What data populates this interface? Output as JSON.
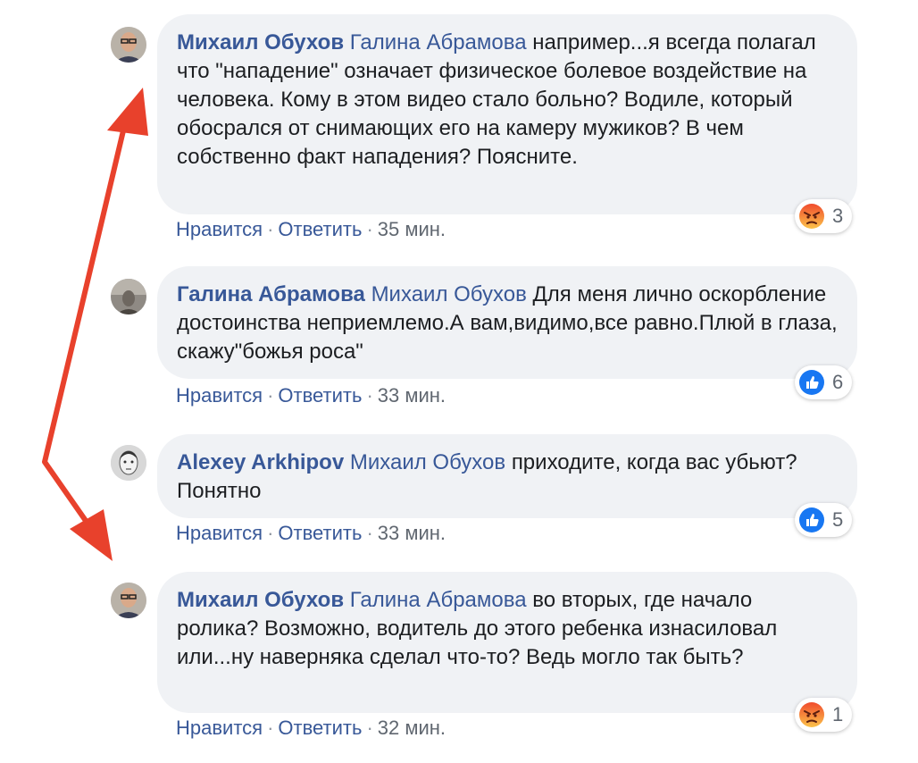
{
  "comments": [
    {
      "author": "Михаил Обухов",
      "mention": "Галина Абрамова",
      "text": "например...я всегда полагал что \"нападение\" означает физическое болевое воздействие на человека. Кому в этом видео стало больно? Водиле, который обосрался от снимающих его на камеру мужиков? В чем собственно факт нападения? Поясните.",
      "like_label": "Нравится",
      "reply_label": "Ответить",
      "time": "35 мин.",
      "reaction_icon": "angry-icon",
      "reaction_count": "3"
    },
    {
      "author": "Галина Абрамова",
      "mention": "Михаил Обухов",
      "text": "Для меня лично оскорбление достоинства неприемлемо.А вам,видимо,все равно.Плюй в глаза, скажу\"божья роса\"",
      "like_label": "Нравится",
      "reply_label": "Ответить",
      "time": "33 мин.",
      "reaction_icon": "like-icon",
      "reaction_count": "6"
    },
    {
      "author": "Alexey Arkhipov",
      "mention": "Михаил Обухов",
      "text": "приходите, когда вас убьют? Понятно",
      "like_label": "Нравится",
      "reply_label": "Ответить",
      "time": "33 мин.",
      "reaction_icon": "like-icon",
      "reaction_count": "5"
    },
    {
      "author": "Михаил Обухов",
      "mention": "Галина Абрамова",
      "text": "во вторых, где начало ролика? Возможно, водитель до этого ребенка изнасиловал или...ну наверняка сделал что-то? Ведь могло так быть?",
      "like_label": "Нравится",
      "reply_label": "Ответить",
      "time": "32 мин.",
      "reaction_icon": "angry-icon",
      "reaction_count": "1"
    }
  ],
  "colors": {
    "link": "#385898",
    "bubble": "#f0f2f5",
    "arrow": "#e8412c",
    "like_blue": "#1877f2",
    "angry_orange": "#f7714c"
  }
}
